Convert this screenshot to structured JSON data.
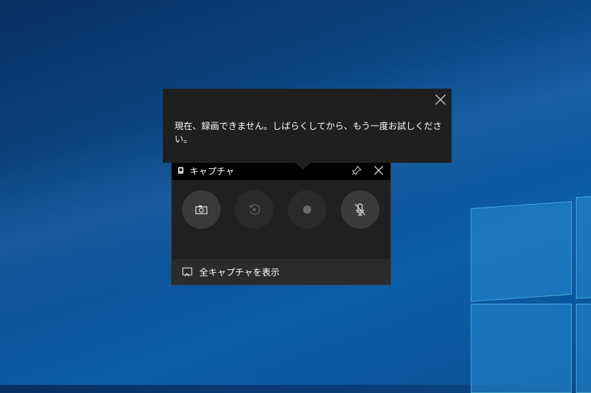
{
  "toast": {
    "message": "現在、録画できません。しばらくしてから、もう一度お試しください。",
    "close_icon": "close-icon"
  },
  "widget": {
    "title": "キャプチャ",
    "buttons": [
      {
        "name": "screenshot",
        "icon": "camera-icon",
        "enabled": true
      },
      {
        "name": "record-last-30s",
        "icon": "replay-icon",
        "enabled": false
      },
      {
        "name": "start-recording",
        "icon": "record-dot-icon",
        "enabled": false
      },
      {
        "name": "microphone-toggle",
        "icon": "mic-off-icon",
        "enabled": true
      }
    ],
    "footer_label": "全キャプチャを表示"
  },
  "colors": {
    "toast_bg": "#1f1f1f",
    "widget_bg": "#202020",
    "button_enabled": "#3a3a3a",
    "button_disabled": "#2a2a2a"
  }
}
